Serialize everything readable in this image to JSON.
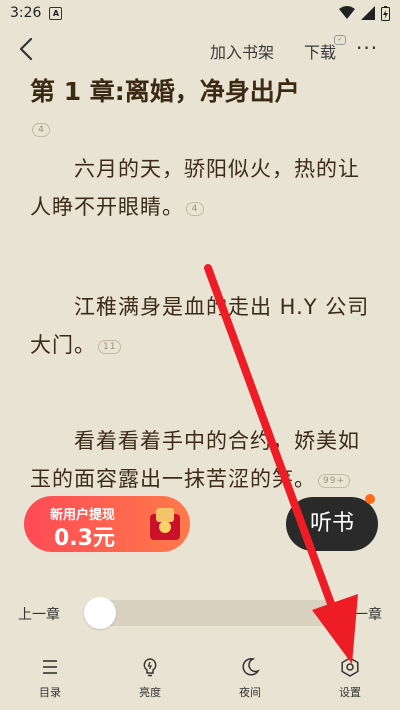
{
  "status_bar": {
    "time": "3:26",
    "notif_letter": "A"
  },
  "top_bar": {
    "add_to_shelf": "加入书架",
    "download": "下载",
    "download_badge": "✓",
    "more": "···"
  },
  "chapter": {
    "title": "第 1 章:离婚，净身出户",
    "title_comment_count": "4",
    "paragraphs": [
      {
        "text": "　　六月的天，骄阳似火，热的让人睁不开眼睛。",
        "comment_count": "4"
      },
      {
        "text": "　　江稚满身是血的走出 H.Y 公司大门。",
        "comment_count": "11"
      },
      {
        "text": "　　看着看着手中的合约，娇美如玉的面容露出一抹苦涩的笑。",
        "comment_count": "99+"
      }
    ]
  },
  "promo": {
    "line1": "新用户提现",
    "amount": "0.3元"
  },
  "listen_button": "听书",
  "progress": {
    "prev_label": "上一章",
    "next_label": "下一章",
    "position": 0.0
  },
  "bottom_nav": [
    {
      "label": "目录",
      "icon": "list-icon"
    },
    {
      "label": "亮度",
      "icon": "brightness-icon"
    },
    {
      "label": "夜间",
      "icon": "moon-icon"
    },
    {
      "label": "设置",
      "icon": "settings-icon"
    }
  ],
  "colors": {
    "background": "#e9e3d3",
    "promo": "#ff4a55",
    "arrow": "#ee1c24"
  }
}
